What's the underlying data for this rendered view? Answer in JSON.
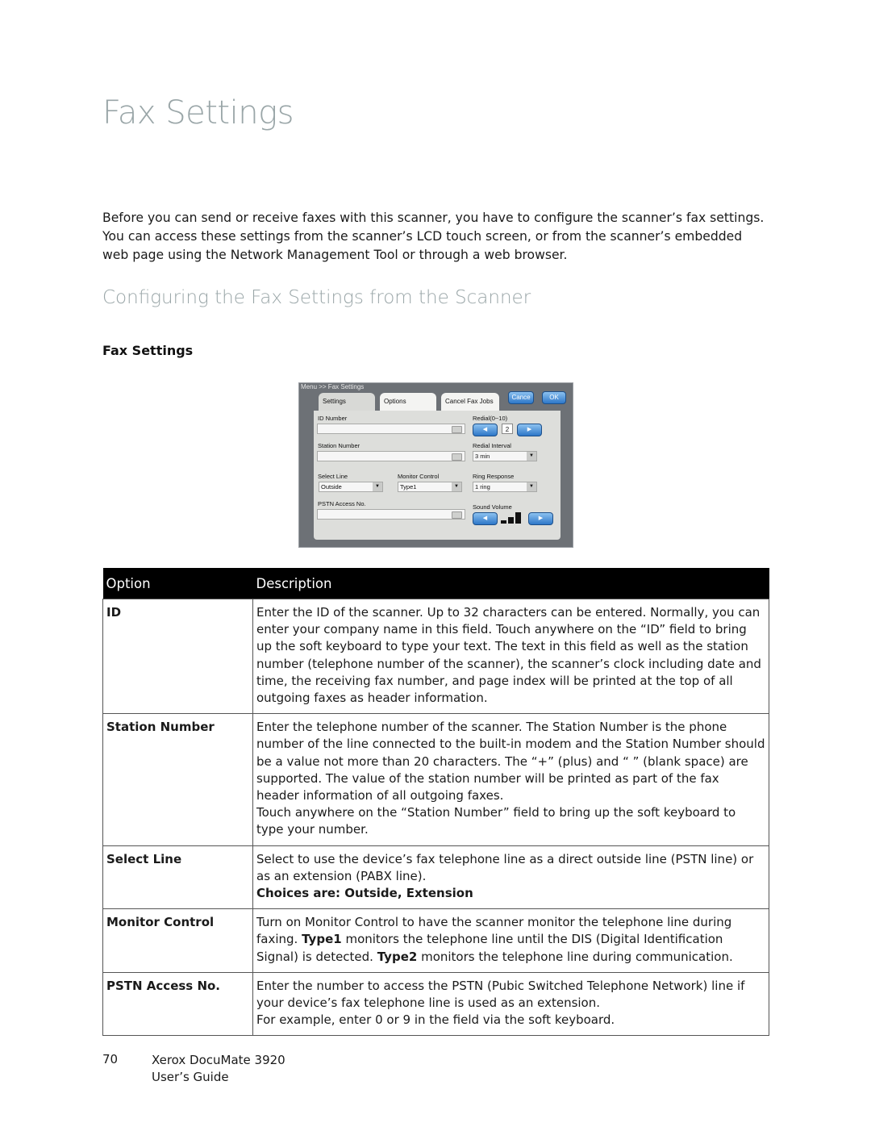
{
  "page": {
    "title": "Fax Settings",
    "intro": "Before you can send or receive faxes with this scanner, you have to configure the scanner’s fax settings. You can access these settings from the scanner’s LCD touch screen, or from the scanner’s embedded web page using the Network Management Tool or through a web browser.",
    "section_title": "Configuring the Fax Settings from the Scanner",
    "sub_title": "Fax Settings"
  },
  "lcd": {
    "breadcrumb": "Menu >> Fax Settings",
    "tabs": [
      {
        "label": "Settings",
        "active": true
      },
      {
        "label": "Options",
        "active": false
      },
      {
        "label": "Cancel Fax Jobs",
        "active": false
      }
    ],
    "cancel_label": "Cance",
    "ok_label": "OK",
    "id_number_label": "ID Number",
    "id_number_value": "",
    "station_number_label": "Station Number",
    "station_number_value": "",
    "redial_label": "Redial(0~10)",
    "redial_value": "2",
    "redial_interval_label": "Redial Interval",
    "redial_interval_value": "3 min",
    "select_line_label": "Select Line",
    "select_line_value": "Outside",
    "monitor_control_label": "Monitor Control",
    "monitor_control_value": "Type1",
    "ring_response_label": "Ring Response",
    "ring_response_value": "1 ring",
    "pstn_label": "PSTN Access No.",
    "pstn_value": "",
    "sound_volume_label": "Sound Volume",
    "sound_volume_level": "3 of 3 bars",
    "left_arrow": "◀",
    "right_arrow": "▶",
    "dropdown_arrow": "▼"
  },
  "table": {
    "headers": [
      "Option",
      "Description"
    ],
    "rows": [
      {
        "option": "ID",
        "desc": [
          "Enter the ID of the scanner. Up to 32 characters can be entered. Normally, you can enter your company name in this field. Touch anywhere on the “ID” field to bring up the soft keyboard to type your text. The text in this field as well as the station number (telephone number of the scanner), the scanner’s clock including date and time, the receiving fax number, and page index will be printed at the top of all outgoing faxes as header information."
        ]
      },
      {
        "option": "Station Number",
        "desc": [
          "Enter the telephone number of the scanner. The Station Number is the phone number of the line connected to the built-in modem and the Station Number should be a value not more than 20 characters. The “+” (plus) and “ ” (blank space) are supported. The value of the station number will be printed as part of the fax header information of all outgoing faxes.",
          "Touch anywhere on the “Station Number” field to bring up the soft keyboard to type your number."
        ]
      },
      {
        "option": "Select Line",
        "desc": [
          "Select to use the device’s fax telephone line as a direct outside line (PSTN line) or as an extension (PABX line)."
        ],
        "bold_note": "Choices are: Outside, Extension"
      },
      {
        "option": "Monitor Control",
        "desc_intro": "Turn on Monitor Control to have the scanner monitor the telephone line during faxing.",
        "type1_label": "Type1",
        "type1_text": " monitors the telephone line until the DIS (Digital Identification Signal) is detected. ",
        "type2_label": "Type2",
        "type2_text": " monitors the telephone line during communication."
      },
      {
        "option": "PSTN Access No.",
        "desc": [
          "Enter the number to access the PSTN (Pubic Switched Telephone Network) line if your device’s fax telephone line is used as an extension.",
          "For example, enter 0 or 9 in the field via the soft keyboard."
        ]
      }
    ]
  },
  "footer": {
    "page_number": "70",
    "doc_title": "Xerox DocuMate 3920",
    "doc_subtitle": "User’s Guide"
  }
}
